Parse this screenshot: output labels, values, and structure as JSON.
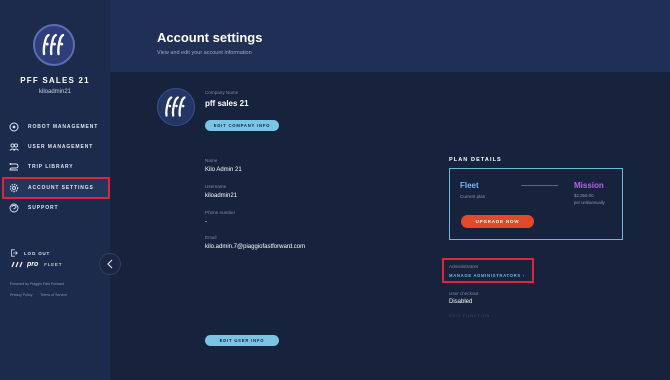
{
  "sidebar": {
    "org_name": "PFF SALES 21",
    "username": "kiloadmin21",
    "items": [
      {
        "label": "ROBOT MANAGEMENT",
        "icon": "robot-icon"
      },
      {
        "label": "USER MANAGEMENT",
        "icon": "users-icon"
      },
      {
        "label": "TRIP LIBRARY",
        "icon": "route-icon"
      },
      {
        "label": "ACCOUNT SETTINGS",
        "icon": "gear-icon",
        "active": true
      },
      {
        "label": "SUPPORT",
        "icon": "support-icon"
      }
    ],
    "logout_label": "LOG OUT",
    "brand_pro": "pro",
    "brand_fleet": "FLEET",
    "powered_by": "Powered by Piaggio Fast Forward",
    "privacy": "Privacy Policy",
    "terms": "Terms of Service"
  },
  "header": {
    "title": "Account settings",
    "subtitle": "View and edit your account information"
  },
  "company": {
    "label": "Company Name",
    "name": "pff sales 21",
    "edit_button": "EDIT COMPANY INFO"
  },
  "user": {
    "name_label": "Name",
    "name": "Kilo Admin 21",
    "username_label": "Username",
    "username": "kiloadmin21",
    "phone_label": "Phone number",
    "phone": "-",
    "email_label": "Email",
    "email": "kilo.admin.7@piaggiofastforward.com",
    "edit_button": "EDIT USER INFO"
  },
  "plan": {
    "title": "PLAN DETAILS",
    "current_name": "Fleet",
    "current_label": "Current plan",
    "upgrade_name": "Mission",
    "upgrade_price": "$2,355.00",
    "upgrade_per": "per unit/annually",
    "upgrade_button": "UPGRADE NOW"
  },
  "admin": {
    "label": "Administrators",
    "link": "MANAGE ADMINISTRATORS ›",
    "checkout_label": "User checkout",
    "checkout_value": "Disabled",
    "edit_function": "EDIT FUNCTION ›"
  },
  "colors": {
    "accent": "#7cc4e4",
    "highlight": "#e0243a",
    "upgrade": "#e04a2a",
    "fleet": "#7ab3ff",
    "mission": "#b95ff0"
  }
}
